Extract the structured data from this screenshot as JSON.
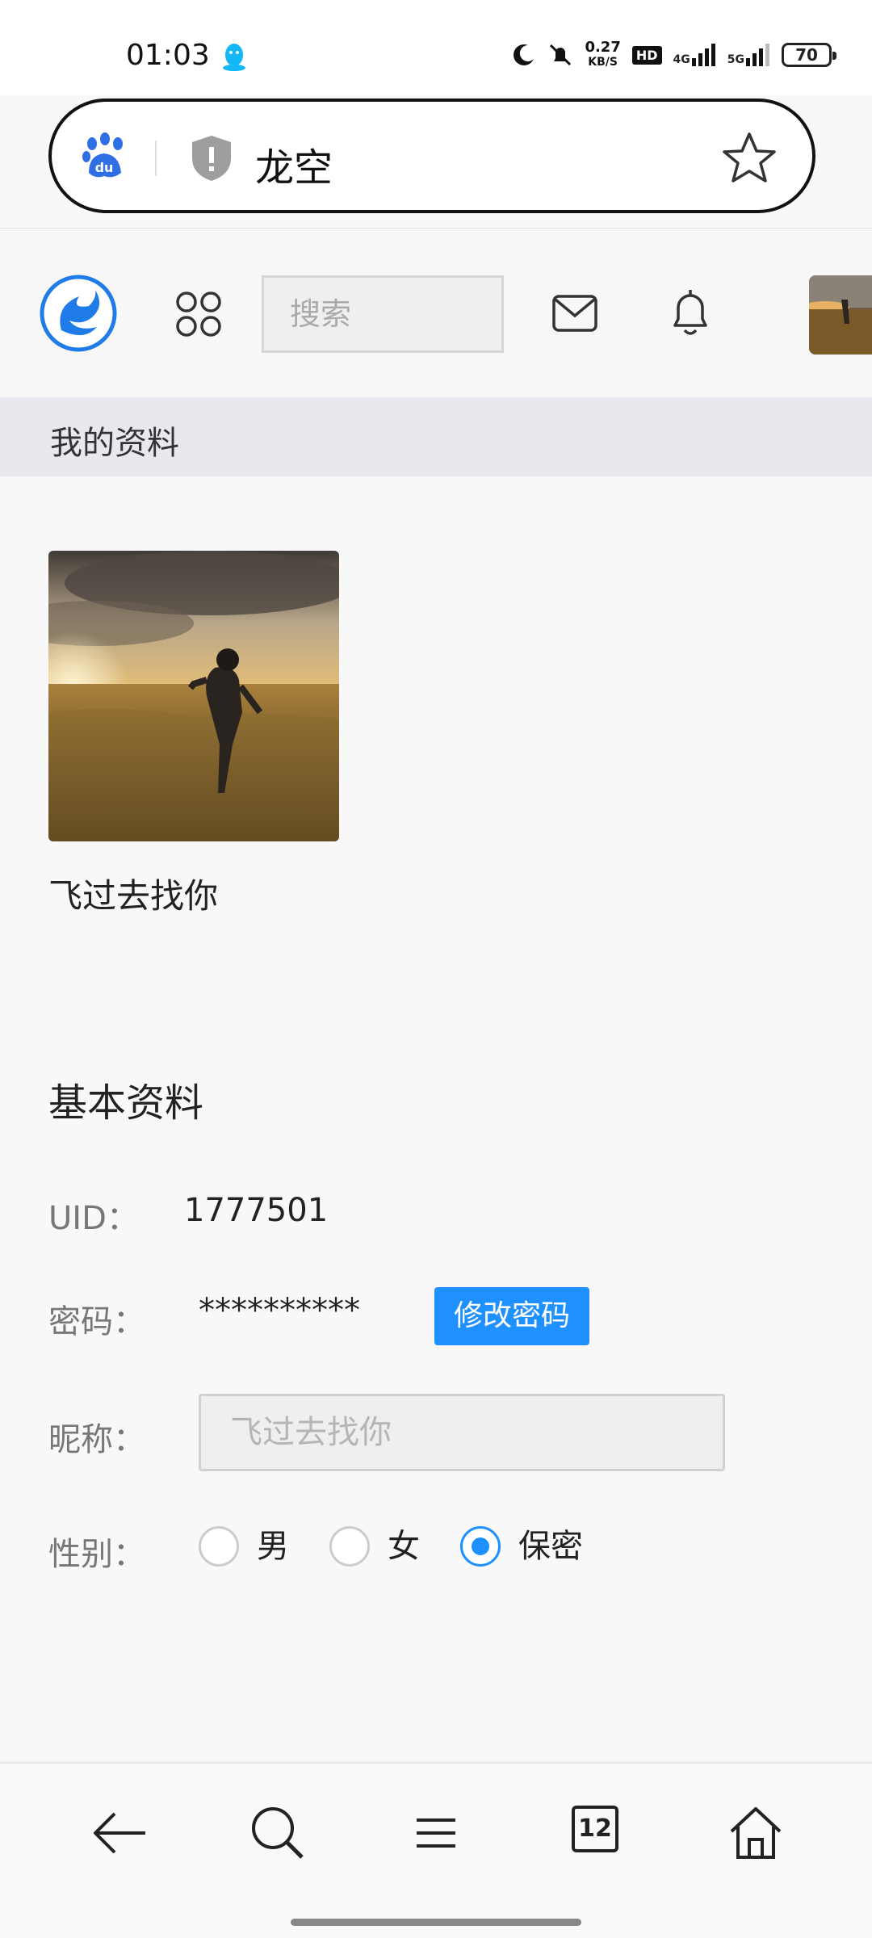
{
  "status_bar": {
    "time": "01:03",
    "net_speed_value": "0.27",
    "net_speed_unit": "KB/S",
    "hd_label": "HD",
    "signal_1": "4G",
    "signal_2": "5G",
    "battery": "70"
  },
  "browser": {
    "url_title": "龙空",
    "tabs_count": "12"
  },
  "header": {
    "search_placeholder": "搜索"
  },
  "section": {
    "title": "我的资料"
  },
  "profile": {
    "nickname": "飞过去找你"
  },
  "basic_info": {
    "title": "基本资料",
    "uid_label": "UID：",
    "uid_value": "1777501",
    "password_label": "密码：",
    "password_value": "**********",
    "change_password_button": "修改密码",
    "nickname_label": "昵称：",
    "nickname_placeholder": "飞过去找你",
    "gender_label": "性别：",
    "gender_options": [
      "男",
      "女",
      "保密"
    ],
    "gender_selected": "保密"
  },
  "colors": {
    "accent": "#1e90ff",
    "section_bg": "#e7e9ee"
  }
}
